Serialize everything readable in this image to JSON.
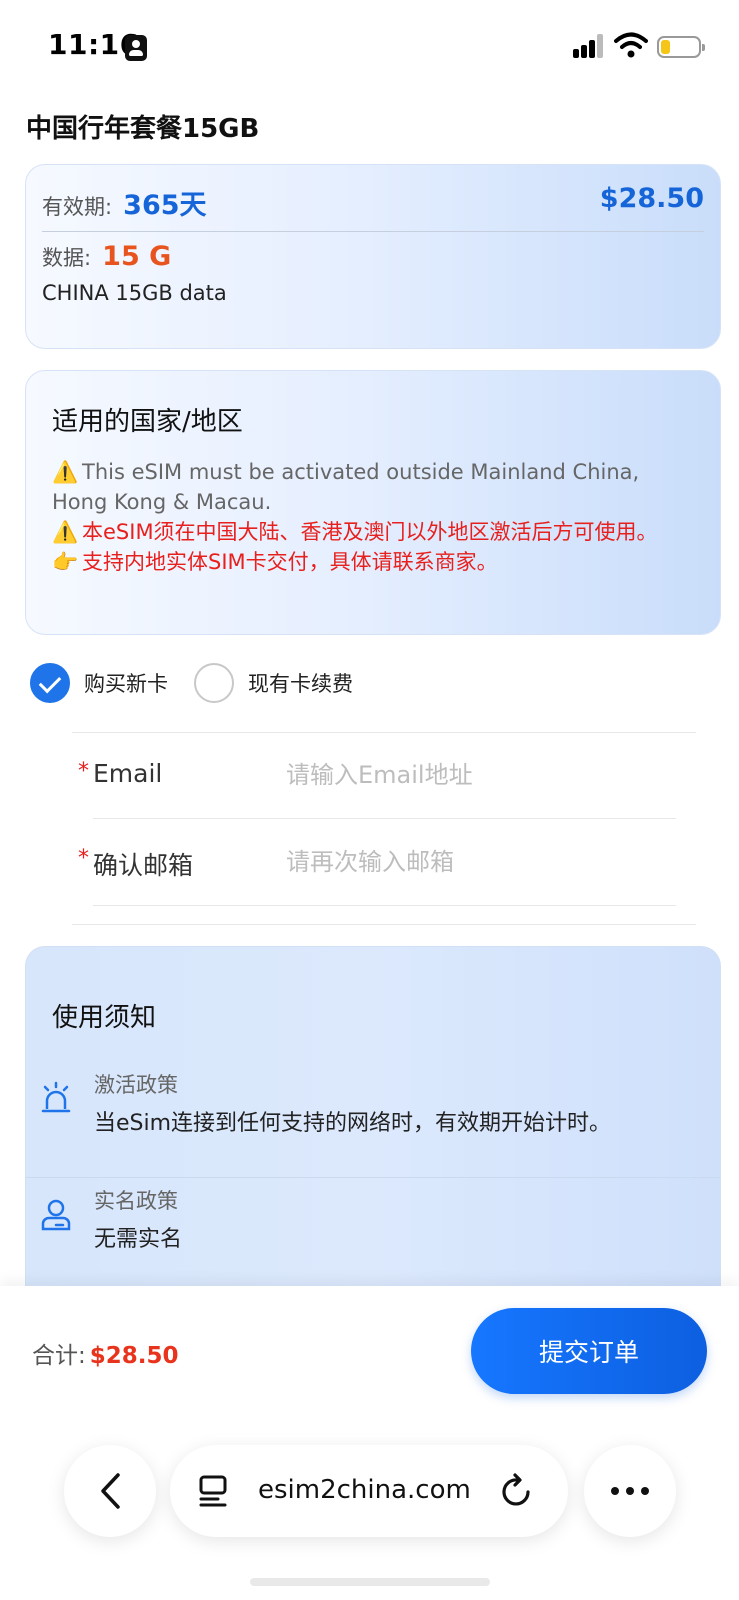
{
  "status_bar": {
    "time": "11:16"
  },
  "page": {
    "title": "中国行年套餐15GB"
  },
  "plan": {
    "validity_label": "有效期:",
    "validity_value": "365天",
    "price": "$28.50",
    "data_label": "数据:",
    "data_value": "15 G",
    "description": "CHINA 15GB data"
  },
  "region": {
    "title": "适用的国家/地区",
    "notes": [
      {
        "icon": "⚠️",
        "text": "This eSIM must be activated outside Mainland China, Hong Kong & Macau."
      },
      {
        "icon": "⚠️",
        "text": "本eSIM须在中国大陆、香港及澳门以外地区激活后方可使用。"
      },
      {
        "icon": "👉",
        "text": "支持内地实体SIM卡交付，具体请联系商家。"
      }
    ]
  },
  "options": {
    "new_card_label": "购买新卡",
    "new_card_checked": true,
    "renew_label": "现有卡续费",
    "renew_checked": false
  },
  "form": {
    "email_label": "Email",
    "email_placeholder": "请输入Email地址",
    "confirm_label": "确认邮箱",
    "confirm_placeholder": "请再次输入邮箱",
    "required_mark": "*"
  },
  "notice": {
    "title": "使用须知",
    "policies": [
      {
        "icon": "alarm-icon",
        "name": "激活政策",
        "value": "当eSim连接到任何支持的网络时，有效期开始计时。"
      },
      {
        "icon": "user-card-icon",
        "name": "实名政策",
        "value": "无需实名"
      }
    ]
  },
  "footer": {
    "total_label": "合计:",
    "total_amount": "$28.50",
    "submit_label": "提交订单"
  },
  "browser": {
    "url": "esim2china.com"
  },
  "colors": {
    "accent": "#1677ff",
    "price_blue": "#1565d8",
    "data_orange": "#e8541e",
    "warning_red": "#e8201d"
  }
}
